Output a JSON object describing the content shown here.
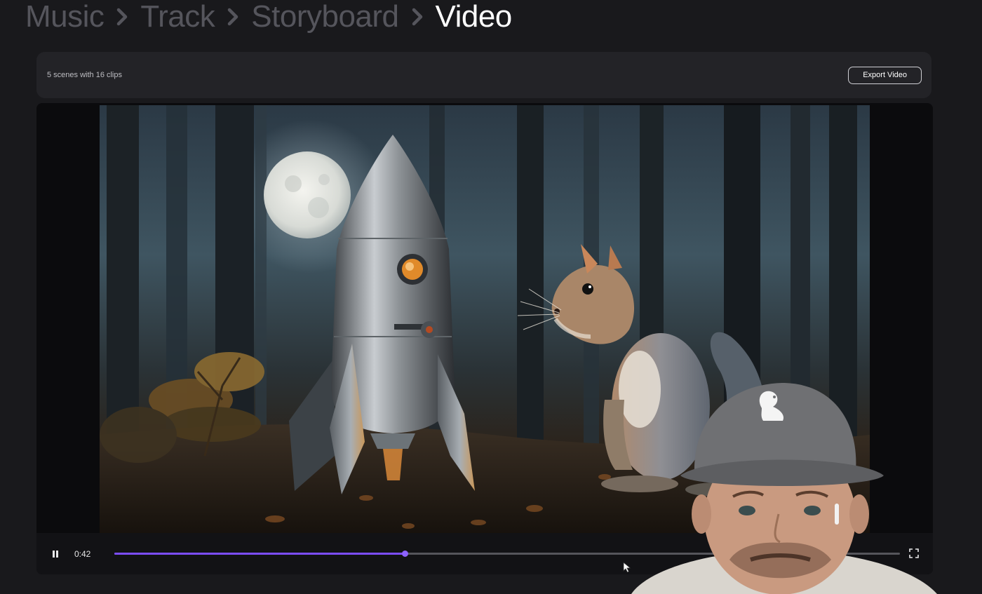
{
  "breadcrumb": {
    "items": [
      {
        "label": "Music",
        "active": false
      },
      {
        "label": "Track",
        "active": false
      },
      {
        "label": "Storyboard",
        "active": false
      },
      {
        "label": "Video",
        "active": true
      }
    ]
  },
  "toolbar": {
    "summary": "5 scenes with 16 clips",
    "export_label": "Export Video"
  },
  "player": {
    "current_time": "0:42",
    "progress": 0.37,
    "state": "playing",
    "icons": {
      "pause": "pause-icon",
      "fullscreen": "fullscreen-icon",
      "separator": "chevron-right-icon"
    }
  },
  "colors": {
    "accent": "#7c4dff",
    "background": "#19191c",
    "panel": "#232327"
  }
}
